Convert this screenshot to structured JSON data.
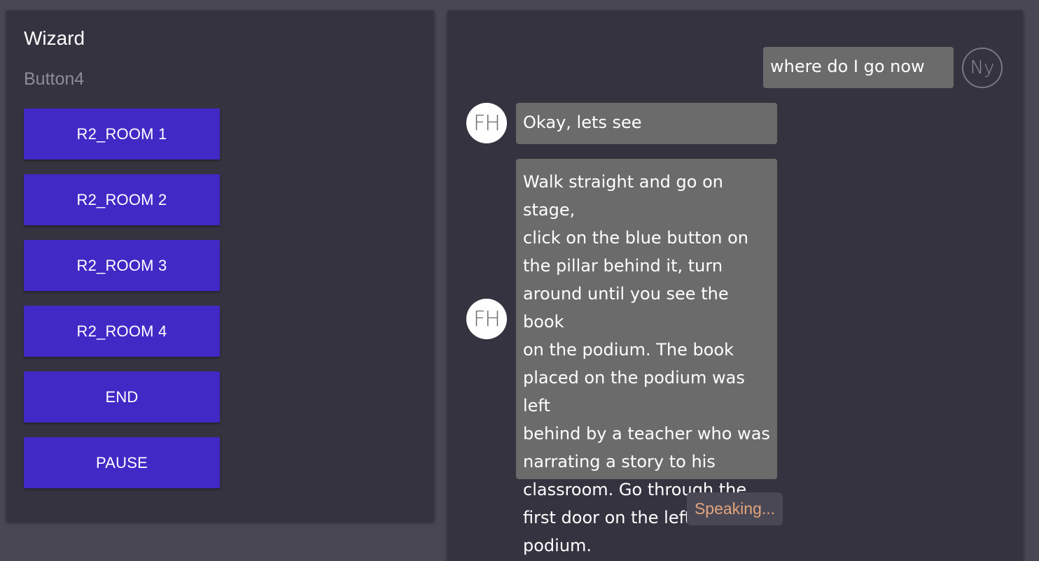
{
  "wizard": {
    "title": "Wizard",
    "subtitle": "Button4",
    "buttons": [
      "R2_ROOM 1",
      "R2_ROOM 2",
      "R2_ROOM 3",
      "R2_ROOM 4",
      "END",
      "PAUSE"
    ]
  },
  "chat": {
    "messages": [
      {
        "sender": "user",
        "avatar": "Ny",
        "text": "where do I go now"
      },
      {
        "sender": "bot",
        "avatar": "FH",
        "text": "Okay, lets see"
      },
      {
        "sender": "bot",
        "avatar": "FH",
        "text": "Walk straight and go on stage,\nclick on the blue button on\nthe pillar behind it, turn\naround until you see the book\non the podium. The book\nplaced on the podium was left\nbehind by a teacher who was\nnarrating a story to his\nclassroom. Go through the\nfirst door on the left of the\npodium."
      }
    ],
    "status": "Speaking..."
  },
  "colors": {
    "background": "#4a4754",
    "panel": "#35333f",
    "button": "#4129c6",
    "bubble": "#6b6b6b",
    "status_text": "#e2a57c"
  }
}
